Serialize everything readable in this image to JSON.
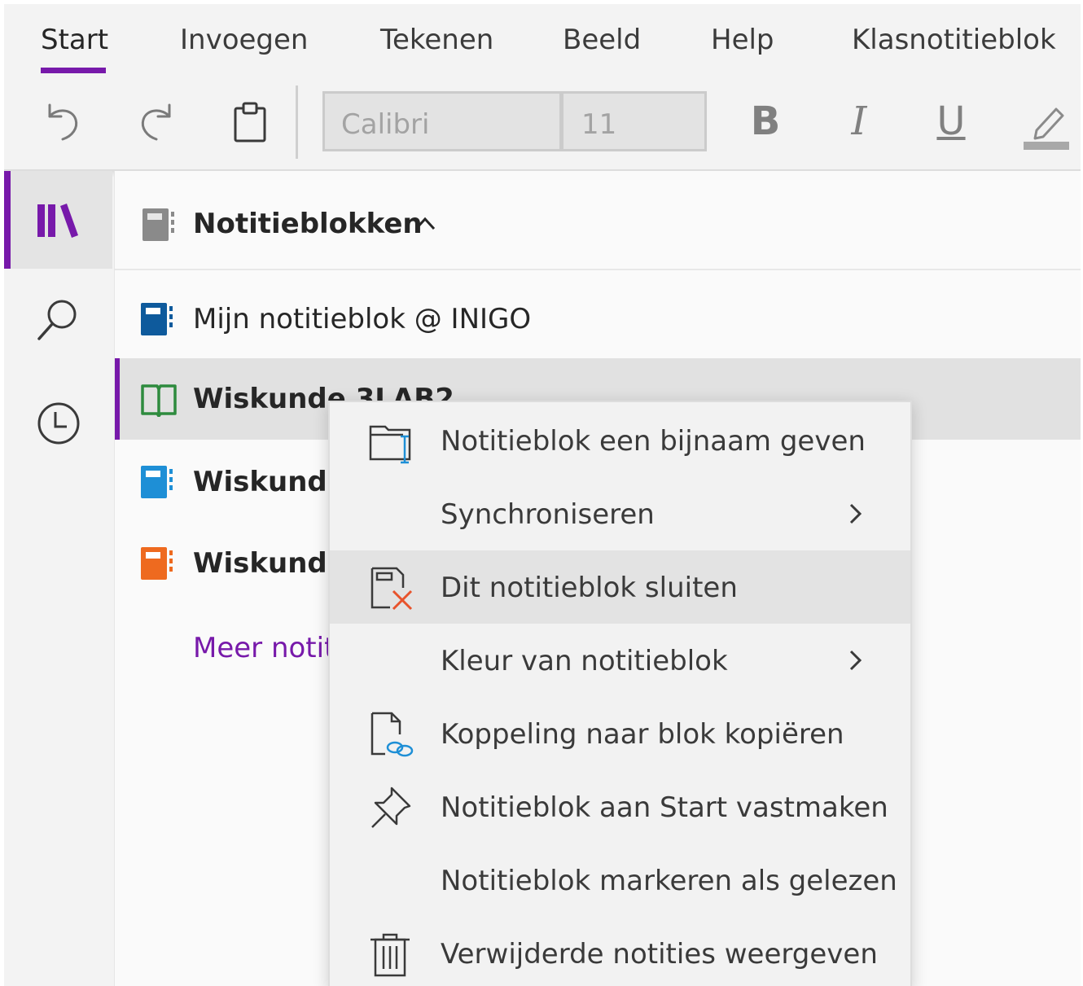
{
  "ribbon": {
    "tabs": [
      {
        "label": "Start",
        "active": true
      },
      {
        "label": "Invoegen"
      },
      {
        "label": "Tekenen"
      },
      {
        "label": "Beeld"
      },
      {
        "label": "Help"
      },
      {
        "label": "Klasnotitieblok"
      }
    ],
    "font_name": "Calibri",
    "font_size": "11",
    "bold_label": "B",
    "italic_label": "I",
    "underline_label": "U",
    "accent_color": "#7719aa"
  },
  "rail": {
    "items": [
      {
        "icon": "notebooks-library-icon",
        "active": true
      },
      {
        "icon": "search-icon"
      },
      {
        "icon": "recent-clock-icon"
      }
    ]
  },
  "panel": {
    "header_title": "Notitieblokken",
    "notebooks": [
      {
        "label": "Mijn notitieblok @ INIGO",
        "color": "#0e5a9c",
        "icon": "notebook-icon"
      },
      {
        "label": "Wiskunde 3LAB2",
        "color": "#2e8b3e",
        "icon": "open-book-icon",
        "selected": true
      },
      {
        "label": "Wiskunde",
        "color": "#1e8fd6",
        "icon": "notebook-icon"
      },
      {
        "label": "Wiskunde",
        "color": "#ee6a1f",
        "icon": "notebook-icon"
      }
    ],
    "more_link": "Meer notit"
  },
  "context_menu": {
    "items": [
      {
        "label": "Notitieblok een bijnaam geven",
        "icon": "rename-notebook-icon"
      },
      {
        "label": "Synchroniseren",
        "submenu": true
      },
      {
        "label": "Dit notitieblok sluiten",
        "icon": "close-notebook-icon",
        "hover": true
      },
      {
        "label": "Kleur van notitieblok",
        "submenu": true
      },
      {
        "label": "Koppeling naar blok kopiëren",
        "icon": "copy-link-icon"
      },
      {
        "label": "Notitieblok aan Start vastmaken",
        "icon": "pin-icon"
      },
      {
        "label": "Notitieblok markeren als gelezen"
      },
      {
        "label": "Verwijderde notities weergeven",
        "icon": "trash-icon"
      }
    ]
  }
}
